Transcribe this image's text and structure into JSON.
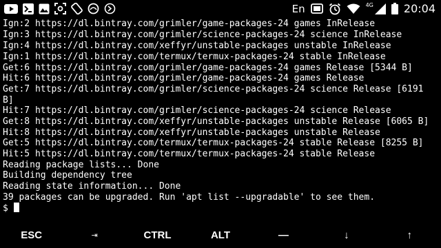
{
  "status_bar": {
    "left_icons": [
      "youtube-icon",
      "terminal-notification-icon",
      "photo-icon",
      "screenshot-icon",
      "screen-rotation-icon",
      "data-saver-icon",
      "music-sync-icon"
    ],
    "keyboard_language": "En",
    "right_icons": [
      "cast-icon",
      "alarm-icon",
      "wifi-icon",
      "cellular-signal-icon",
      "battery-icon"
    ],
    "network_type": "4G",
    "time": "20:04"
  },
  "terminal": {
    "lines": [
      "Ign:2 https://dl.bintray.com/grimler/game-packages-24 games InRelease",
      "Ign:3 https://dl.bintray.com/grimler/science-packages-24 science InRelease",
      "Ign:4 https://dl.bintray.com/xeffyr/unstable-packages unstable InRelease",
      "Ign:1 https://dl.bintray.com/termux/termux-packages-24 stable InRelease",
      "Get:6 https://dl.bintray.com/grimler/game-packages-24 games Release [5344 B]",
      "Hit:6 https://dl.bintray.com/grimler/game-packages-24 games Release",
      "Get:7 https://dl.bintray.com/grimler/science-packages-24 science Release [6191",
      "B]",
      "Hit:7 https://dl.bintray.com/grimler/science-packages-24 science Release",
      "Get:8 https://dl.bintray.com/xeffyr/unstable-packages unstable Release [6065 B]",
      "Hit:8 https://dl.bintray.com/xeffyr/unstable-packages unstable Release",
      "Get:5 https://dl.bintray.com/termux/termux-packages-24 stable Release [8255 B]",
      "Hit:5 https://dl.bintray.com/termux/termux-packages-24 stable Release",
      "Reading package lists... Done",
      "Building dependency tree",
      "Reading state information... Done",
      "39 packages can be upgraded. Run 'apt list --upgradable' to see them."
    ],
    "prompt": "$"
  },
  "extra_keys": {
    "esc": "ESC",
    "tab": "⇥",
    "ctrl": "CTRL",
    "alt": "ALT",
    "dash": "—",
    "down": "↓",
    "up": "↑"
  }
}
